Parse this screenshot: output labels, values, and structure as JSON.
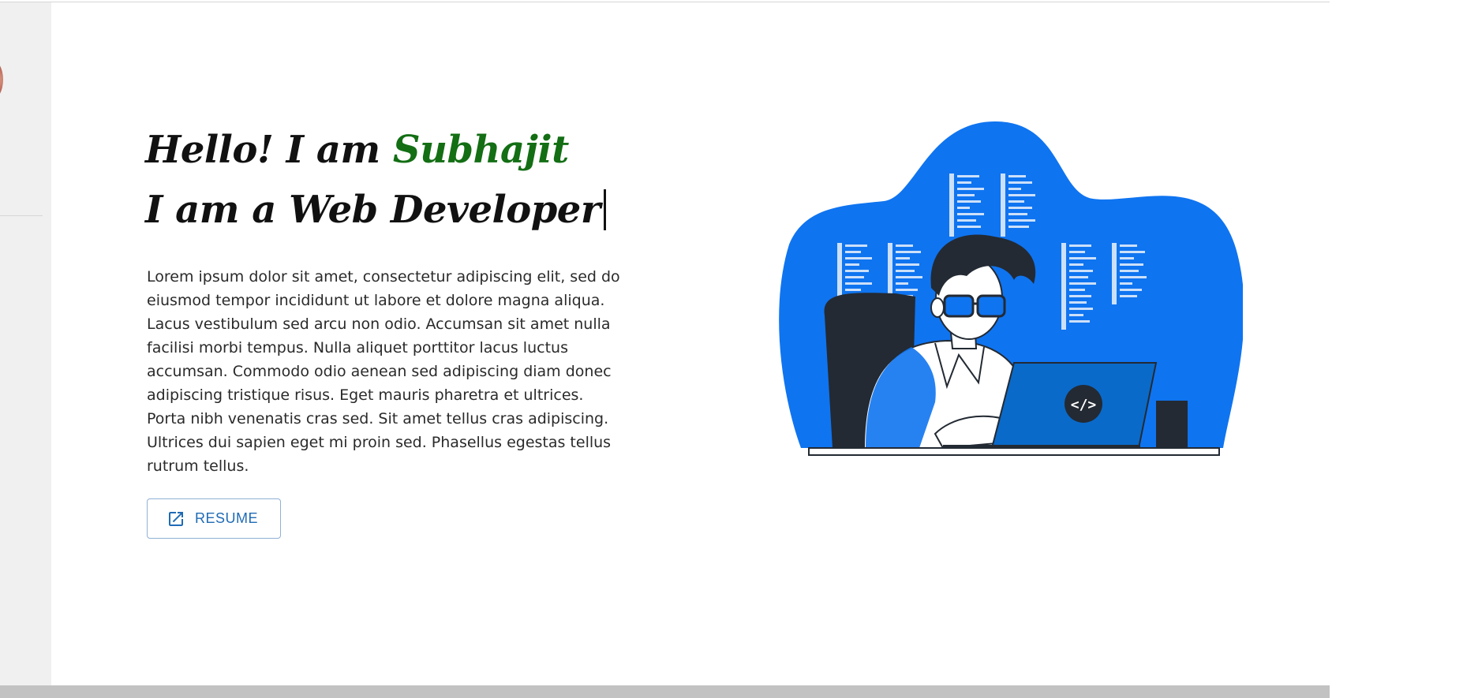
{
  "hero": {
    "greeting": "Hello! I am ",
    "name": "Subhajit",
    "role_line": "I am a Web Developer",
    "paragraph": "Lorem ipsum dolor sit amet, consectetur adipiscing elit, sed do eiusmod tempor incididunt ut labore et dolore magna aliqua. Lacus vestibulum sed arcu non odio. Accumsan sit amet nulla facilisi morbi tempus. Nulla aliquet porttitor lacus luctus accumsan. Commodo odio aenean sed adipiscing diam donec adipiscing tristique risus. Eget mauris pharetra et ultrices. Porta nibh venenatis cras sed. Sit amet tellus cras adipiscing. Ultrices dui sapien eget mi proin sed. Phasellus egestas tellus rutrum tellus.",
    "resume_label": "RESUME",
    "resume_icon": "open-in-new-icon",
    "laptop_code_glyph": "</>"
  },
  "colors": {
    "accent_name": "#136e14",
    "button_text": "#1f6bb5",
    "illustration_blue": "#0f74f0"
  }
}
